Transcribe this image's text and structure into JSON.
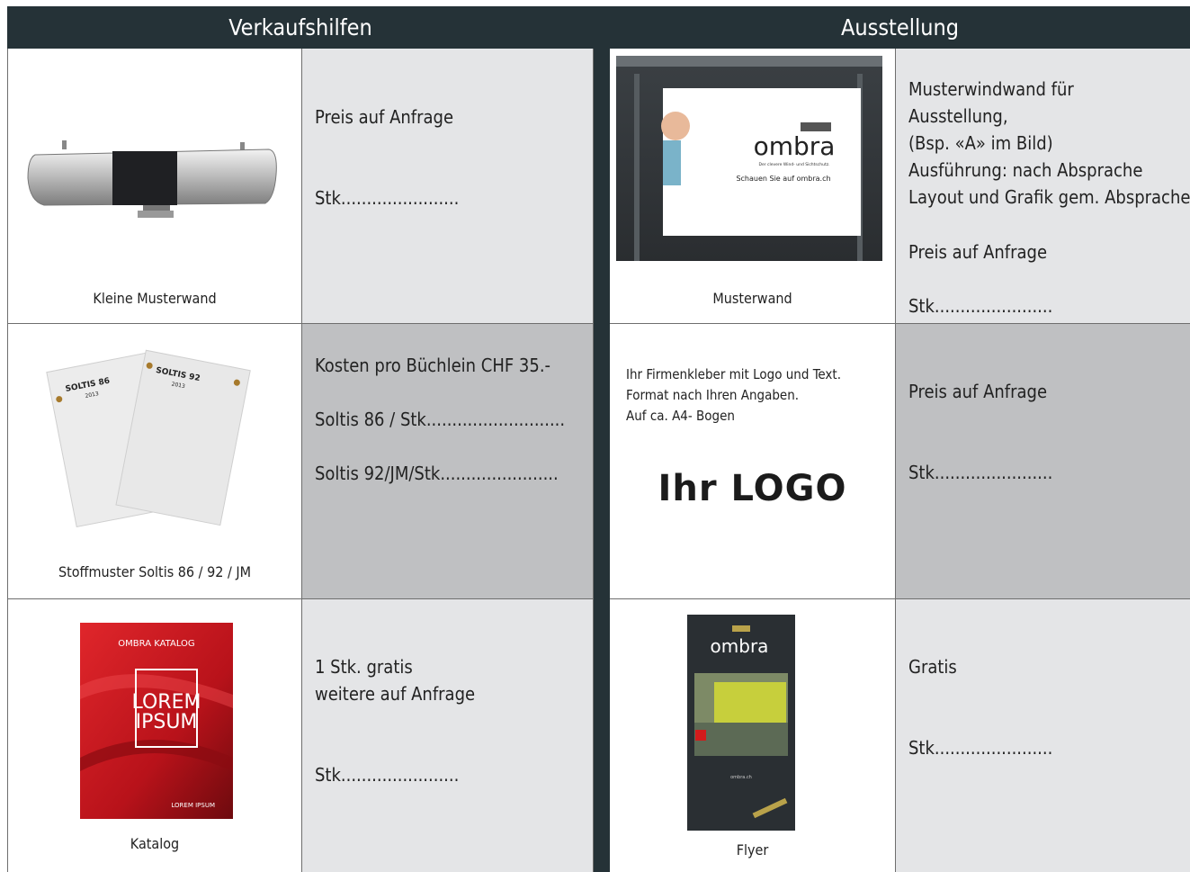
{
  "headers": {
    "left": "Verkaufshilfen",
    "right": "Ausstellung"
  },
  "verkaufshilfen": [
    {
      "caption": "Kleine Musterwand",
      "lines": [
        "Preis auf Anfrage",
        "Stk......................."
      ]
    },
    {
      "caption": "Stoffmuster Soltis 86 / 92 / JM",
      "lines": [
        "Kosten pro Büchlein CHF 35.-",
        "Soltis 86 / Stk...........................",
        "Soltis 92/JM/Stk......................."
      ],
      "swatch1": "SOLTIS 86",
      "swatch2": "SOLTIS 92",
      "swatch_year": "2013"
    },
    {
      "caption": "Katalog",
      "lines": [
        "1 Stk. gratis",
        "weitere auf Anfrage",
        "Stk......................."
      ],
      "catalog_title": "OMBRA KATALOG",
      "catalog_main1": "LOREM",
      "catalog_main2": "IPSUM",
      "catalog_footer": "LOREM IPSUM"
    }
  ],
  "ausstellung": [
    {
      "caption": "Musterwand",
      "lines": [
        "Musterwindwand für",
        "Ausstellung,",
        "(Bsp. «A» im Bild)",
        "Ausführung: nach Absprache",
        "Layout und Grafik gem. Absprache",
        "Preis auf Anfrage",
        "Stk......................."
      ],
      "brand": "ombra",
      "brand_sub": "Der clevere Wind- und Sichtschutz.",
      "brand_url": "Schauen Sie auf ombra.ch"
    },
    {
      "caption_lines": [
        "Ihr Firmenkleber mit Logo und Text.",
        "Format nach Ihren Angaben.",
        "Auf ca. A4- Bogen"
      ],
      "logo": "Ihr LOGO",
      "lines": [
        "Preis auf Anfrage",
        "Stk......................."
      ]
    },
    {
      "caption": "Flyer",
      "lines": [
        "Gratis",
        "Stk......................."
      ],
      "brand": "ombra",
      "flyer_url": "ombra.ch"
    }
  ],
  "colors": {
    "header_bg": "#253237",
    "light_cell": "#e4e5e7",
    "dark_cell": "#bfc0c2",
    "catalog_red": "#c4161c"
  }
}
